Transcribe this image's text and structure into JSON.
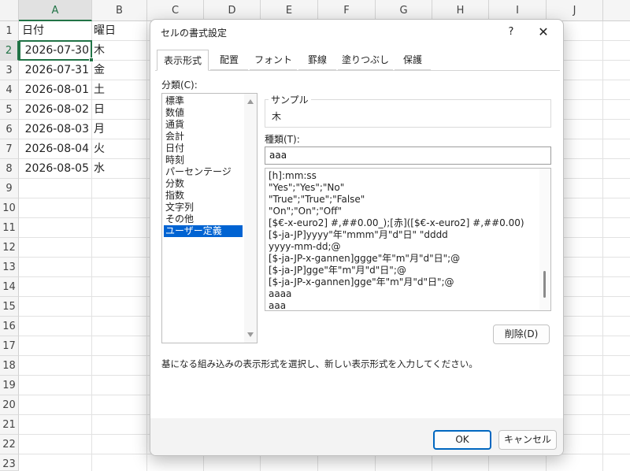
{
  "sheet": {
    "column_headers": [
      "A",
      "B",
      "C",
      "D",
      "E",
      "F",
      "G",
      "H",
      "I",
      "J"
    ],
    "row_headers": [
      "1",
      "2",
      "3",
      "4",
      "5",
      "6",
      "7",
      "8",
      "9",
      "10",
      "11",
      "12",
      "13",
      "14",
      "15",
      "16",
      "17",
      "18",
      "19",
      "20",
      "21",
      "22",
      "23"
    ],
    "rows": [
      {
        "a": "日付",
        "b": "曜日"
      },
      {
        "a": "2026-07-30",
        "b": "木"
      },
      {
        "a": "2026-07-31",
        "b": "金"
      },
      {
        "a": "2026-08-01",
        "b": "土"
      },
      {
        "a": "2026-08-02",
        "b": "日"
      },
      {
        "a": "2026-08-03",
        "b": "月"
      },
      {
        "a": "2026-08-04",
        "b": "火"
      },
      {
        "a": "2026-08-05",
        "b": "水"
      }
    ],
    "active_cell": "A2",
    "accent_color": "#217346"
  },
  "dialog": {
    "title": "セルの書式設定",
    "help_label": "?",
    "close_label": "✕",
    "tabs": [
      "表示形式",
      "配置",
      "フォント",
      "罫線",
      "塗りつぶし",
      "保護"
    ],
    "active_tab": "表示形式",
    "category_label": "分類(C):",
    "categories": [
      "標準",
      "数値",
      "通貨",
      "会計",
      "日付",
      "時刻",
      "パーセンテージ",
      "分数",
      "指数",
      "文字列",
      "その他",
      "ユーザー定義"
    ],
    "selected_category": "ユーザー定義",
    "sample_label": "サンプル",
    "sample_value": "木",
    "type_label": "種類(T):",
    "type_value": "aaa",
    "format_list": [
      "[h]:mm:ss",
      "\"Yes\";\"Yes\";\"No\"",
      "\"True\";\"True\";\"False\"",
      "\"On\";\"On\";\"Off\"",
      "[$€-x-euro2] #,##0.00_);[赤]([$€-x-euro2] #,##0.00)",
      "[$-ja-JP]yyyy\"年\"mmm\"月\"d\"日\" \"dddd",
      "yyyy-mm-dd;@",
      "[$-ja-JP-x-gannen]ggge\"年\"m\"月\"d\"日\";@",
      "[$-ja-JP]gge\"年\"m\"月\"d\"日\";@",
      "[$-ja-JP-x-gannen]gge\"年\"m\"月\"d\"日\";@",
      "aaaa",
      "aaa"
    ],
    "delete_label": "削除(D)",
    "description": "基になる組み込みの表示形式を選択し、新しい表示形式を入力してください。",
    "ok_label": "OK",
    "cancel_label": "キャンセル",
    "selection_color": "#0063d2",
    "primary_border_color": "#0067c0"
  }
}
